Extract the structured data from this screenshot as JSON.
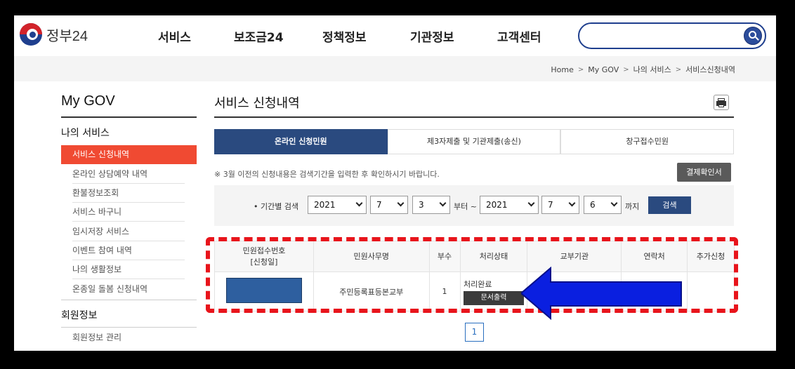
{
  "header": {
    "logo_text": "정부24",
    "nav": [
      "서비스",
      "보조금24",
      "정책정보",
      "기관정보",
      "고객센터"
    ],
    "search_placeholder": ""
  },
  "breadcrumb": [
    "Home",
    "My GOV",
    "나의 서비스",
    "서비스신청내역"
  ],
  "sidebar": {
    "title": "My GOV",
    "section1": "나의 서비스",
    "items": [
      "서비스 신청내역",
      "온라인 상담예약 내역",
      "환불정보조회",
      "서비스 바구니",
      "임시저장 서비스",
      "이벤트 참여 내역",
      "나의 생활정보",
      "온종일 돌봄 신청내역"
    ],
    "section2": "회원정보",
    "items2": [
      "회원정보 관리"
    ]
  },
  "main": {
    "title": "서비스 신청내역",
    "tabs": [
      "온라인 신청민원",
      "제3자제출 및 기관제출(송신)",
      "창구접수민원"
    ],
    "notice": "※ 3월 이전의 신청내용은 검색기간을 입력한 후 확인하시기 바랍니다.",
    "pay_button": "결제확인서",
    "filter": {
      "label": "• 기간별 검색",
      "from_year": "2021",
      "from_month": "7",
      "from_day": "3",
      "from_suffix": "부터 ~",
      "to_year": "2021",
      "to_month": "7",
      "to_day": "6",
      "to_suffix": "까지",
      "search_button": "검색"
    },
    "table": {
      "headers": [
        "민원접수번호\n[신청일]",
        "민원사무명",
        "부수",
        "처리상태",
        "교부기관",
        "연락처",
        "추가신청"
      ],
      "header_line1": "민원접수번호",
      "header_line2": "[신청일]",
      "rows": [
        {
          "service_name": "주민등록표등본교부",
          "copies": "1",
          "status": "처리완료",
          "doc_button": "문서출력"
        }
      ]
    },
    "pagination": [
      "1"
    ]
  },
  "colors": {
    "accent": "#2a4a7f",
    "sidebar_active": "#f04a32",
    "highlight_dash": "#e8141b",
    "arrow": "#0a1fe0"
  }
}
